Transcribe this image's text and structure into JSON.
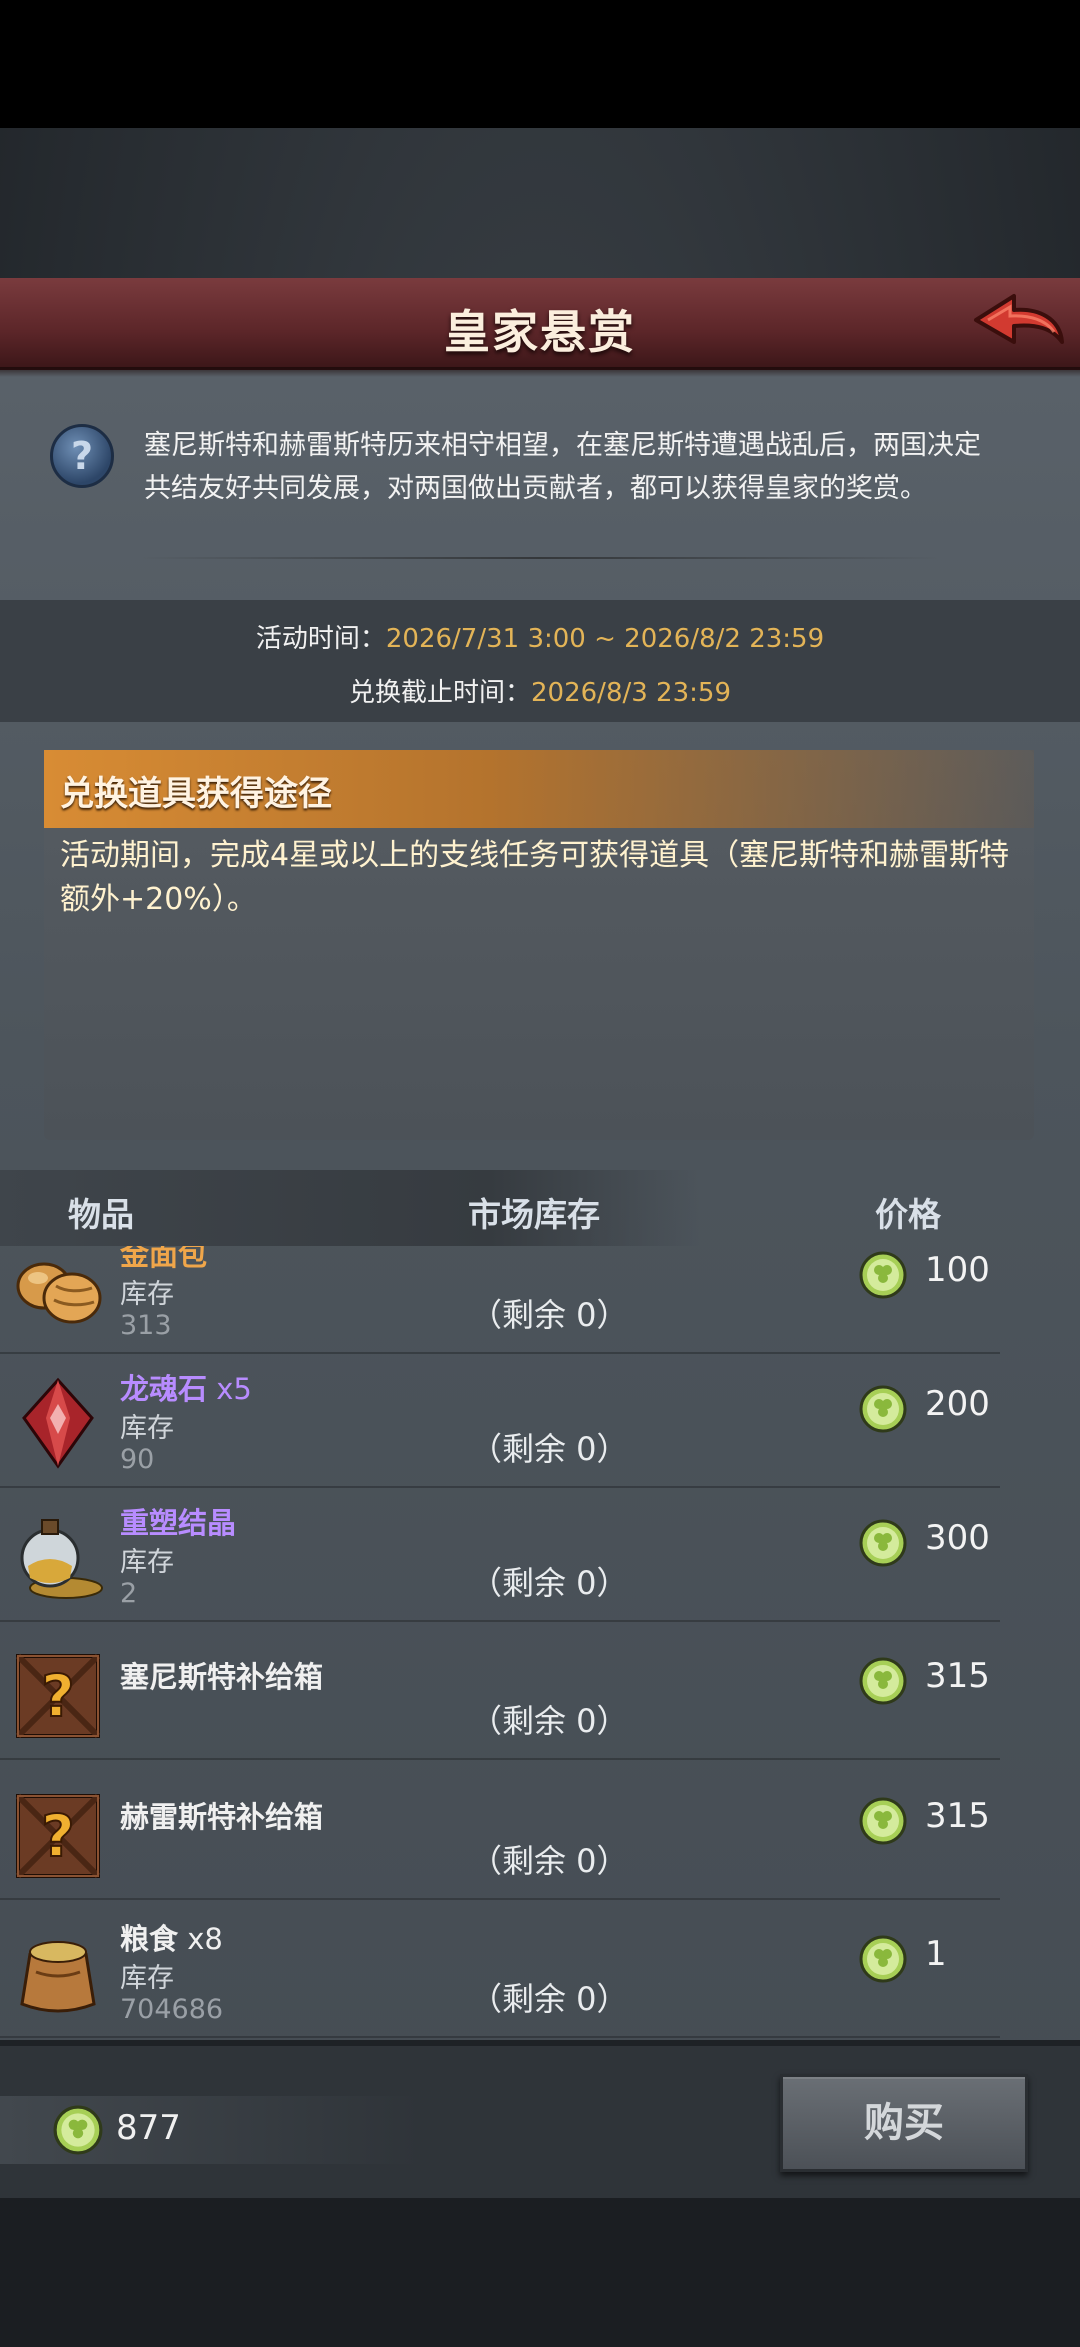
{
  "header": {
    "title": "皇家悬赏"
  },
  "intro": {
    "text": "塞尼斯特和赫雷斯特历来相守相望，在塞尼斯特遭遇战乱后，两国决定共结友好共同发展，对两国做出贡献者，都可以获得皇家的奖赏。"
  },
  "event": {
    "activity_label": "活动时间：",
    "activity_value": "2026/7/31 3:00 ~ 2026/8/2 23:59",
    "exchange_label": "兑换截止时间：",
    "exchange_value": "2026/8/3 23:59"
  },
  "info": {
    "title": "兑换道具获得途径",
    "body": "活动期间，完成4星或以上的支线任务可获得道具（塞尼斯特和赫雷斯特额外+20%）。"
  },
  "table": {
    "col_item": "物品",
    "col_stock": "市场库存",
    "col_price": "价格",
    "rows": [
      {
        "name": "金面包",
        "qty": "",
        "stock_label": "库存",
        "stock": "313",
        "remain": "（剩余 0）",
        "price": "100",
        "color": "#f0a64a",
        "icon": "bread-icon"
      },
      {
        "name": "龙魂石",
        "qty": " x5",
        "stock_label": "库存",
        "stock": "90",
        "remain": "（剩余 0）",
        "price": "200",
        "color": "#b88cff",
        "icon": "red-gem-icon"
      },
      {
        "name": "重塑结晶",
        "qty": "",
        "stock_label": "库存",
        "stock": "2",
        "remain": "（剩余 0）",
        "price": "300",
        "color": "#b88cff",
        "icon": "potion-flask-icon"
      },
      {
        "name": "塞尼斯特补给箱",
        "qty": "",
        "stock_label": "",
        "stock": "",
        "remain": "（剩余 0）",
        "price": "315",
        "color": "#f0f0f0",
        "icon": "mystery-crate-icon"
      },
      {
        "name": "赫雷斯特补给箱",
        "qty": "",
        "stock_label": "",
        "stock": "",
        "remain": "（剩余 0）",
        "price": "315",
        "color": "#f0f0f0",
        "icon": "mystery-crate-icon"
      },
      {
        "name": "粮食",
        "qty": " x8",
        "stock_label": "库存",
        "stock": "704686",
        "remain": "（剩余 0）",
        "price": "1",
        "color": "#f0f0f0",
        "icon": "grain-sack-icon"
      }
    ]
  },
  "footer": {
    "balance": "877",
    "buy_label": "购买"
  },
  "colors": {
    "accent_orange": "#d88c34",
    "time_value": "#e3b457",
    "banner_red": "#5c2629",
    "rare_purple": "#b88cff"
  }
}
